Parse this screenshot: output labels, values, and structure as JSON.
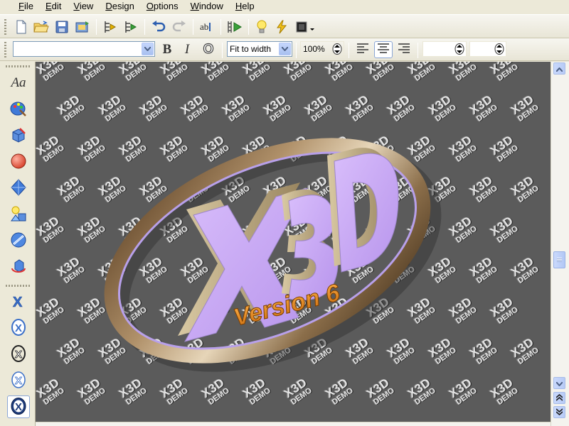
{
  "menu": [
    {
      "label": "File",
      "key": "F"
    },
    {
      "label": "Edit",
      "key": "E"
    },
    {
      "label": "View",
      "key": "V"
    },
    {
      "label": "Design",
      "key": "D"
    },
    {
      "label": "Options",
      "key": "O"
    },
    {
      "label": "Window",
      "key": "W"
    },
    {
      "label": "Help",
      "key": "H"
    }
  ],
  "toolbar": {
    "font_combo_value": "",
    "bold_label": "B",
    "italic_label": "I",
    "outline_label": "O",
    "view_mode": "Fit to width",
    "zoom": "100%",
    "size_field_1": "",
    "size_field_2": ""
  },
  "palette": {
    "text_tool_label": "Aa"
  },
  "watermark": {
    "line1": "X3D",
    "line2": "DEMO"
  },
  "logo": {
    "main_text": "X3D",
    "subtitle": "Version 6"
  },
  "colors": {
    "viewport_bg": "#5b5b5b",
    "logo_face": "#c8a8f2",
    "logo_side": "#b8a57c",
    "ring": "#8b6e4a",
    "subtitle": "#e08a1e"
  }
}
